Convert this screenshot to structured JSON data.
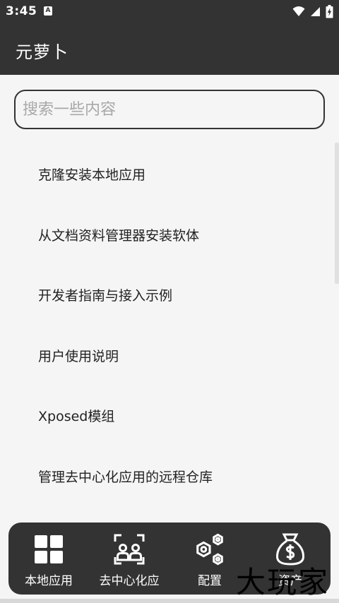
{
  "status_bar": {
    "time": "3:45",
    "notification_badge": "A"
  },
  "app_bar": {
    "title": "元萝卜"
  },
  "search": {
    "placeholder": "搜索一些内容",
    "value": ""
  },
  "menu": {
    "items": [
      {
        "label": "克隆安装本地应用"
      },
      {
        "label": "从文档资料管理器安装软体"
      },
      {
        "label": "开发者指南与接入示例"
      },
      {
        "label": "用户使用说明"
      },
      {
        "label": "Xposed模组"
      },
      {
        "label": "管理去中心化应用的远程仓库"
      }
    ]
  },
  "bottom_nav": {
    "items": [
      {
        "label": "本地应用",
        "icon": "grid-icon"
      },
      {
        "label": "去中心化应",
        "icon": "network-users-icon"
      },
      {
        "label": "配置",
        "icon": "hexagon-nuts-icon"
      },
      {
        "label": "资产",
        "icon": "money-bag-icon"
      }
    ]
  },
  "watermark": {
    "text": "大玩家"
  },
  "colors": {
    "dark": "#333333",
    "background": "#f5f5f5",
    "text": "#222222",
    "placeholder": "#a8a8a8"
  }
}
